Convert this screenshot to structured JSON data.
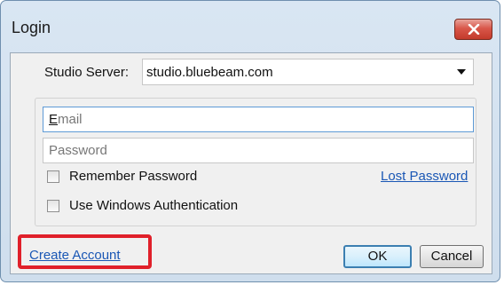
{
  "window": {
    "title": "Login"
  },
  "server": {
    "label": "Studio Server:",
    "value": "studio.bluebeam.com"
  },
  "credentials": {
    "email_first": "E",
    "email_rest": "mail",
    "password_placeholder": "Password"
  },
  "options": {
    "remember_label": "Remember Password",
    "remember_checked": false,
    "windows_auth_label": "Use Windows Authentication",
    "windows_auth_checked": false,
    "lost_password_link": "Lost Password"
  },
  "footer": {
    "create_account_link": "Create  Account",
    "ok_label": "OK",
    "cancel_label": "Cancel"
  },
  "icons": {
    "close": "close-icon",
    "dropdown": "chevron-down-icon"
  },
  "colors": {
    "highlight": "#e0202a",
    "link": "#1a57b5",
    "close_button": "#c33a2b"
  }
}
